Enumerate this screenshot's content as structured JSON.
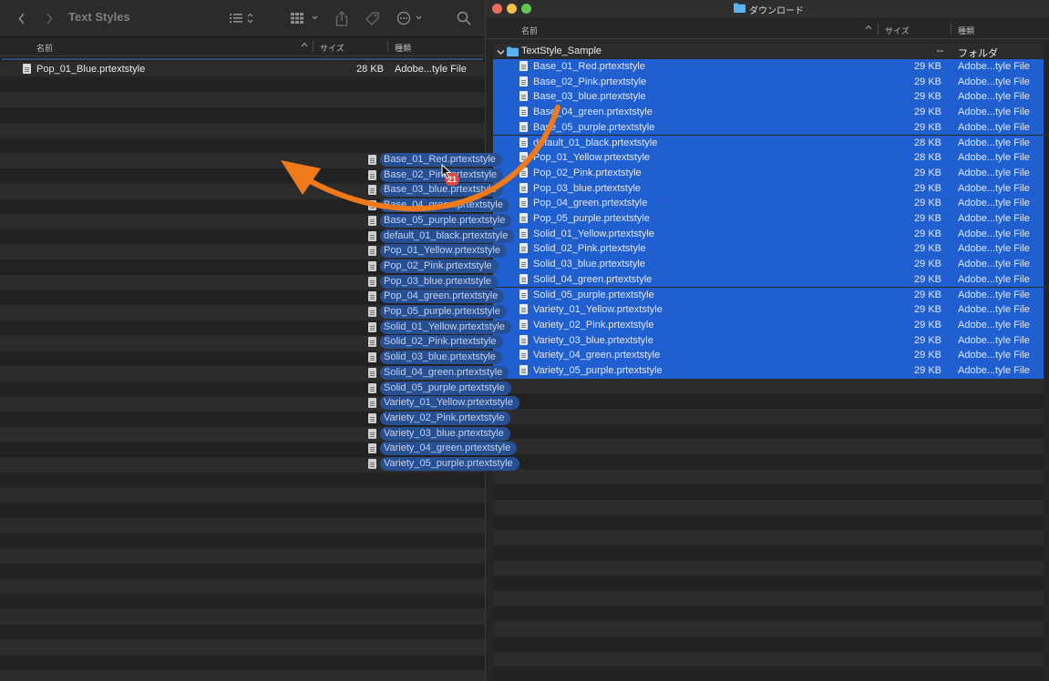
{
  "left_window": {
    "title": "Text Styles",
    "columns": {
      "name": "名前",
      "size": "サイズ",
      "kind": "種類"
    },
    "files": [
      {
        "name": "Pop_01_Blue.prtextstyle",
        "size": "28 KB",
        "kind": "Adobe...tyle File"
      }
    ]
  },
  "right_window": {
    "title": "ダウンロード",
    "columns": {
      "name": "名前",
      "size": "サイズ",
      "kind": "種類"
    },
    "folder": {
      "name": "TextStyle_Sample",
      "size": "--",
      "kind": "フォルダ"
    },
    "files": [
      {
        "name": "Base_01_Red.prtextstyle",
        "size": "29 KB",
        "kind": "Adobe...tyle File"
      },
      {
        "name": "Base_02_Pink.prtextstyle",
        "size": "29 KB",
        "kind": "Adobe...tyle File"
      },
      {
        "name": "Base_03_blue.prtextstyle",
        "size": "29 KB",
        "kind": "Adobe...tyle File"
      },
      {
        "name": "Base_04_green.prtextstyle",
        "size": "29 KB",
        "kind": "Adobe...tyle File"
      },
      {
        "name": "Base_05_purple.prtextstyle",
        "size": "29 KB",
        "kind": "Adobe...tyle File"
      },
      {
        "name": "default_01_black.prtextstyle",
        "size": "28 KB",
        "kind": "Adobe...tyle File"
      },
      {
        "name": "Pop_01_Yellow.prtextstyle",
        "size": "28 KB",
        "kind": "Adobe...tyle File"
      },
      {
        "name": "Pop_02_Pink.prtextstyle",
        "size": "29 KB",
        "kind": "Adobe...tyle File"
      },
      {
        "name": "Pop_03_blue.prtextstyle",
        "size": "29 KB",
        "kind": "Adobe...tyle File"
      },
      {
        "name": "Pop_04_green.prtextstyle",
        "size": "29 KB",
        "kind": "Adobe...tyle File"
      },
      {
        "name": "Pop_05_purple.prtextstyle",
        "size": "29 KB",
        "kind": "Adobe...tyle File"
      },
      {
        "name": "Solid_01_Yellow.prtextstyle",
        "size": "29 KB",
        "kind": "Adobe...tyle File"
      },
      {
        "name": "Solid_02_Pink.prtextstyle",
        "size": "29 KB",
        "kind": "Adobe...tyle File"
      },
      {
        "name": "Solid_03_blue.prtextstyle",
        "size": "29 KB",
        "kind": "Adobe...tyle File"
      },
      {
        "name": "Solid_04_green.prtextstyle",
        "size": "29 KB",
        "kind": "Adobe...tyle File"
      },
      {
        "name": "Solid_05_purple.prtextstyle",
        "size": "29 KB",
        "kind": "Adobe...tyle File"
      },
      {
        "name": "Variety_01_Yellow.prtextstyle",
        "size": "29 KB",
        "kind": "Adobe...tyle File"
      },
      {
        "name": "Variety_02_Pink.prtextstyle",
        "size": "29 KB",
        "kind": "Adobe...tyle File"
      },
      {
        "name": "Variety_03_blue.prtextstyle",
        "size": "29 KB",
        "kind": "Adobe...tyle File"
      },
      {
        "name": "Variety_04_green.prtextstyle",
        "size": "29 KB",
        "kind": "Adobe...tyle File"
      },
      {
        "name": "Variety_05_purple.prtextstyle",
        "size": "29 KB",
        "kind": "Adobe...tyle File"
      }
    ]
  },
  "drag": {
    "count_badge": "21",
    "arrow_color": "#f07a1a"
  },
  "icons": [
    "back-chevron-icon",
    "forward-chevron-icon",
    "list-view-icon",
    "grid-view-icon",
    "share-icon",
    "tag-icon",
    "more-icon",
    "search-icon",
    "file-icon",
    "folder-icon",
    "disclosure-chevron-icon",
    "sort-chevron-icon"
  ],
  "colors": {
    "selection": "#1f5fcf",
    "ghost": "#264f94",
    "folder": "#5ab2f2",
    "badge": "#e0463a"
  }
}
